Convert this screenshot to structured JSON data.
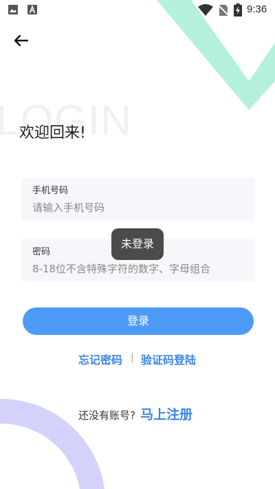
{
  "status_bar": {
    "time": "9:36",
    "icons": [
      "gallery-icon",
      "font-icon",
      "wifi-icon",
      "no-sim-icon",
      "battery-charging-icon"
    ]
  },
  "nav": {
    "back_icon": "arrow-left-icon"
  },
  "header": {
    "watermark": "LOGIN",
    "welcome": "欢迎回来!"
  },
  "form": {
    "phone": {
      "label": "手机号码",
      "placeholder": "请输入手机号码",
      "value": ""
    },
    "password": {
      "label": "密码",
      "placeholder": "8-18位不含特殊字符的数字、字母组合",
      "value": ""
    },
    "submit_label": "登录"
  },
  "toast": {
    "text": "未登录"
  },
  "links": {
    "forgot_password": "忘记密码",
    "divider": "|",
    "sms_login": "验证码登陆"
  },
  "register": {
    "prompt": "还没有账号?",
    "link": "马上注册"
  },
  "colors": {
    "accent": "#4d9bf7",
    "link": "#3a86e8",
    "deco_check": "#b5f0dc",
    "deco_arc": "#d4d2fb",
    "field_bg": "#f7f7fb",
    "toast_bg": "#3c3c3c"
  }
}
